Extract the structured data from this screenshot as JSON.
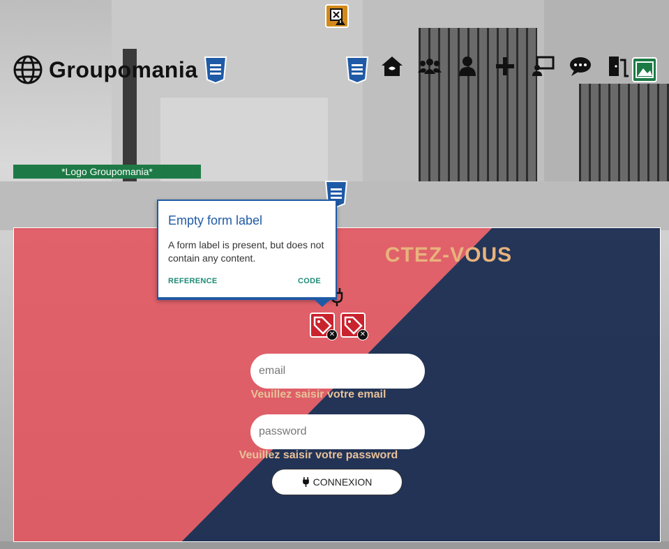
{
  "header": {
    "brand": "Groupomania",
    "nav_icons": [
      "home-icon",
      "users-icon",
      "user-icon",
      "plus-icon",
      "chat-screen-icon",
      "comments-icon",
      "logout-door-icon"
    ]
  },
  "logo_alt_text": "*Logo Groupomania*",
  "form": {
    "title_visible": "CTEZ-VOUS",
    "email_placeholder": "email",
    "email_hint": "Veuillez saisir votre email",
    "password_placeholder": "password",
    "password_hint": "Veuillez saisir votre password",
    "submit_label": "CONNEXION"
  },
  "tooltip": {
    "title": "Empty form label",
    "body": "A form label is present, but does not contain any content.",
    "reference_link": "REFERENCE",
    "code_link": "CODE"
  },
  "colors": {
    "accent_green": "#1d7a46",
    "card_red": "#e2525c",
    "card_blue": "#16284e",
    "title_gold": "#e8b37d",
    "tooltip_blue": "#1f5aa6"
  }
}
